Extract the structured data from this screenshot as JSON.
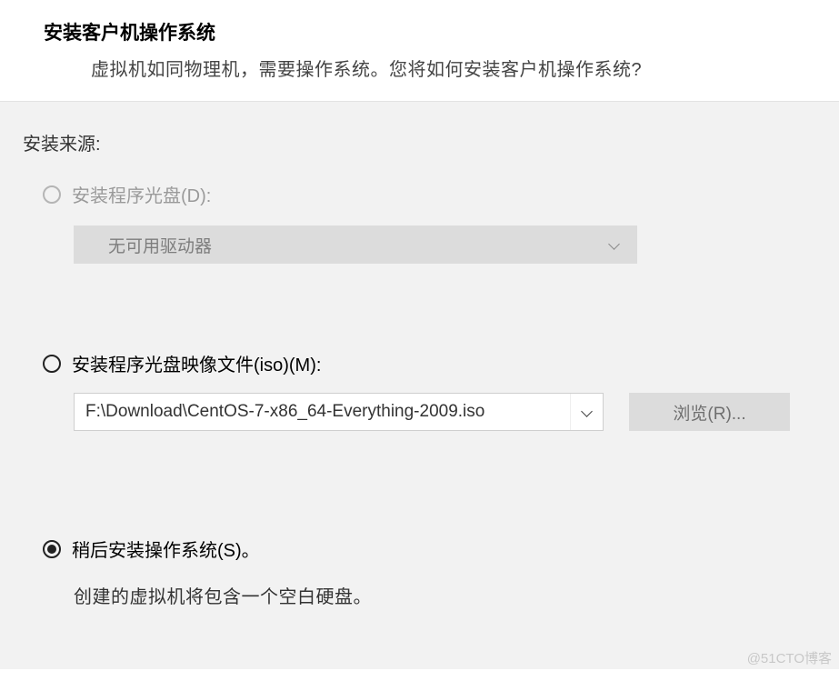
{
  "header": {
    "title": "安装客户机操作系统",
    "subtitle": "虚拟机如同物理机，需要操作系统。您将如何安装客户机操作系统?"
  },
  "body": {
    "section_label": "安装来源:",
    "option_disc": {
      "label": "安装程序光盘(D):",
      "dropdown_text": "无可用驱动器"
    },
    "option_iso": {
      "label": "安装程序光盘映像文件(iso)(M):",
      "path": "F:\\Download\\CentOS-7-x86_64-Everything-2009.iso",
      "browse_label": "浏览(R)..."
    },
    "option_later": {
      "label": "稍后安装操作系统(S)。",
      "hint": "创建的虚拟机将包含一个空白硬盘。"
    }
  },
  "watermark": "@51CTO博客"
}
